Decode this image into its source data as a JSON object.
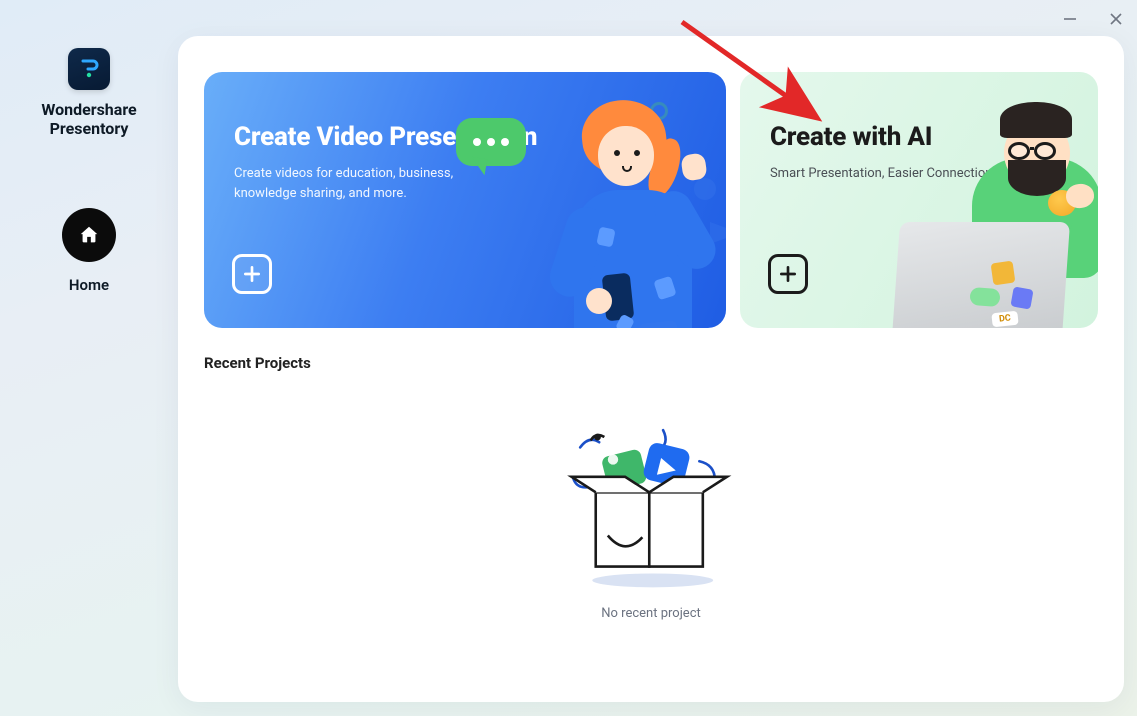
{
  "brand": {
    "line1": "Wondershare",
    "line2": "Presentory"
  },
  "nav": {
    "home_label": "Home"
  },
  "cards": {
    "video": {
      "title": "Create Video Presentation",
      "subtitle": "Create videos for education, business, knowledge sharing, and more."
    },
    "ai": {
      "title": "Create with AI",
      "subtitle": "Smart Presentation, Easier Connection."
    }
  },
  "recent": {
    "section_title": "Recent Projects",
    "empty_label": "No recent project"
  },
  "sticker_dc": "DC"
}
